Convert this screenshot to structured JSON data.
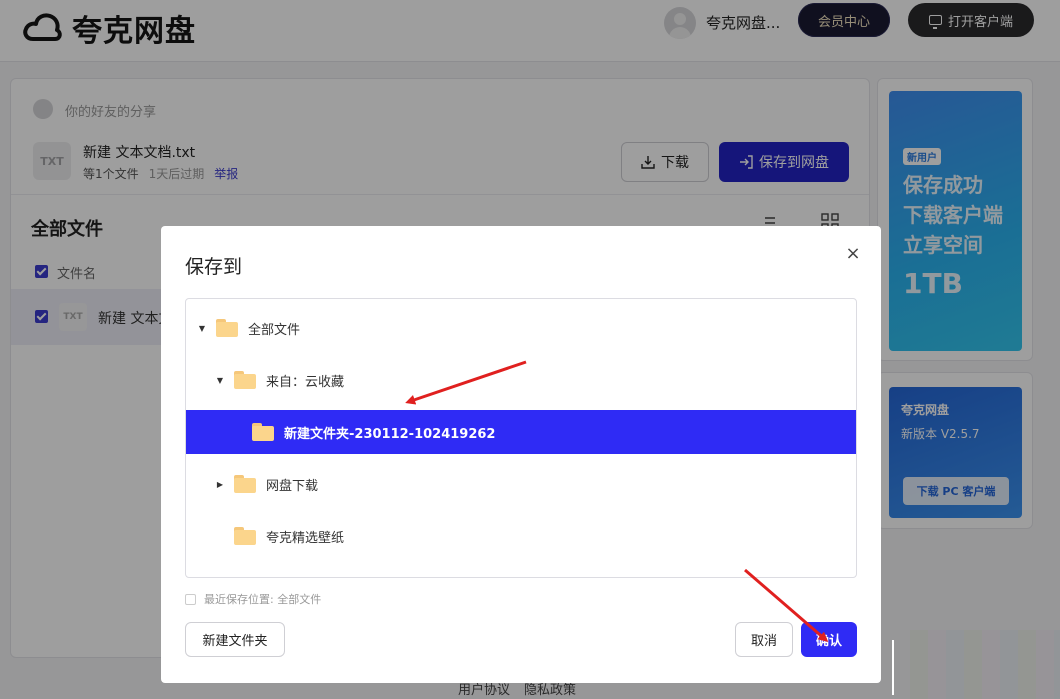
{
  "header": {
    "brand": "夸克网盘",
    "user_name": "夸克网盘...",
    "vip_label": "会员中心",
    "client_label": "打开客户端"
  },
  "share": {
    "friend_label": "你的好友的分享",
    "file_icon_text": "TXT",
    "file_name": "新建 文本文档.txt",
    "file_count": "等1个文件",
    "expiry": "1天后过期",
    "report": "举报",
    "download_label": "下载",
    "save_label": "保存到网盘"
  },
  "files": {
    "title": "全部文件",
    "col_name": "文件名",
    "rows": [
      {
        "icon_text": "TXT",
        "name": "新建 文本文"
      }
    ]
  },
  "ads": {
    "ad1": {
      "badge": "新用户",
      "lines": [
        "保存成功",
        "下载客户端",
        "立享空间"
      ],
      "big": "1TB"
    },
    "ad2": {
      "title": "夸克网盘",
      "version": "新版本 V2.5.7",
      "button": "下载 PC 客户端"
    }
  },
  "footer": {
    "links": [
      "用户协议",
      "隐私政策"
    ]
  },
  "dialog": {
    "title": "保存到",
    "close_symbol": "×",
    "tree": [
      {
        "label": "全部文件",
        "caret": "▼",
        "selected": false
      },
      {
        "label": "来自：云收藏",
        "caret": "▼",
        "selected": false
      },
      {
        "label": "新建文件夹-230112-102419262",
        "caret": "",
        "selected": true
      },
      {
        "label": "网盘下载",
        "caret": "▶",
        "selected": false
      },
      {
        "label": "夸克精选壁纸",
        "caret": "",
        "selected": false
      }
    ],
    "recent_label": "最近保存位置: 全部文件",
    "new_folder_label": "新建文件夹",
    "cancel_label": "取消",
    "confirm_label": "确认"
  },
  "colors": {
    "accent": "#2f2bf5",
    "primary_button": "#2323c6",
    "annotation_arrow": "#e0201f"
  }
}
